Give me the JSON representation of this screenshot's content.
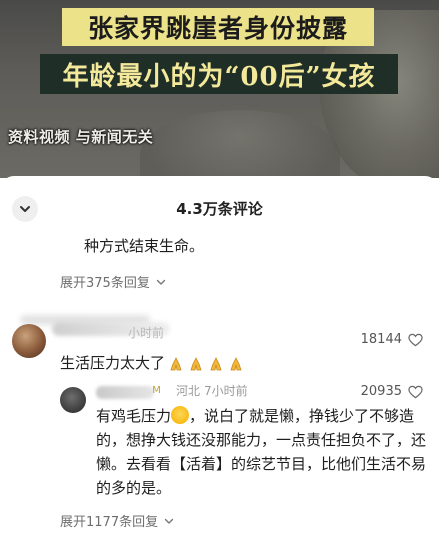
{
  "video": {
    "headline_line1": "张家界跳崖者身份披露",
    "headline_line2": "年龄最小的为“00后”女孩",
    "caption": "资料视频 与新闻无关"
  },
  "comments_sheet": {
    "title": "4.3万条评论",
    "collapse_icon": "chevron-down-icon",
    "previous_comment_tail": "种方式结束生命。",
    "previous_expand_label": "展开375条回复",
    "top_comment": {
      "time_fragment": "小时前",
      "text": "生活压力太大了",
      "emoji": [
        "folded-hands",
        "folded-hands",
        "folded-hands",
        "folded-hands"
      ],
      "like_count": "18144"
    },
    "reply": {
      "location": "河北",
      "time": "7小时前",
      "like_count": "20935",
      "text_before_emoji": "有鸡毛压力",
      "text_after_emoji": "，说白了就是懒，挣钱少了不够造的，想挣大钱还没那能力，一点责任担负不了，还懒。去看看【活着】的综艺节目，比他们生活不易的多的是。"
    },
    "expand_label": "展开1177条回复",
    "colors": {
      "headline1_bg": "#ece28a",
      "headline2_bg": "#1f2f28",
      "headline2_fg": "#f4e99a",
      "meta_gray": "#9a9a9a",
      "link_gray": "#6e6e6e"
    }
  }
}
